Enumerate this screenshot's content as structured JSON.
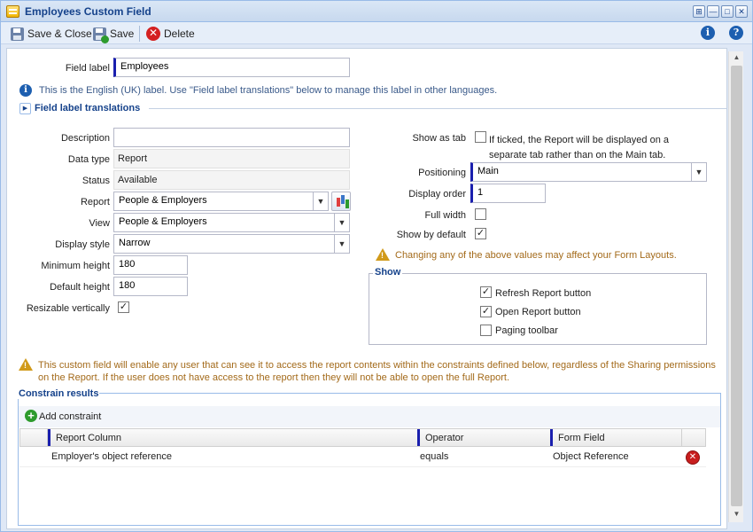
{
  "window": {
    "title": "Employees Custom Field",
    "buttons": {
      "pin": "⊞",
      "minimize": "—",
      "maximize": "□",
      "close": "✕"
    }
  },
  "toolbar": {
    "save_close": "Save & Close",
    "save": "Save",
    "delete": "Delete",
    "info_glyph": "i",
    "help_glyph": "?"
  },
  "form": {
    "field_label": {
      "label": "Field label",
      "value": "Employees"
    },
    "label_note": "This is the English (UK) label. Use \"Field label translations\" below to manage this label in other languages.",
    "translations_header": "Field label translations",
    "description": {
      "label": "Description",
      "value": ""
    },
    "data_type": {
      "label": "Data type",
      "value": "Report"
    },
    "status": {
      "label": "Status",
      "value": "Available"
    },
    "report": {
      "label": "Report",
      "value": "People & Employers"
    },
    "view": {
      "label": "View",
      "value": "People & Employers"
    },
    "display_style": {
      "label": "Display style",
      "value": "Narrow"
    },
    "min_height": {
      "label": "Minimum height",
      "value": "180"
    },
    "default_height": {
      "label": "Default height",
      "value": "180"
    },
    "resizable": {
      "label": "Resizable vertically",
      "checked": true
    },
    "show_as_tab": {
      "label": "Show as tab",
      "checked": false,
      "desc_line1": "If ticked, the Report will be displayed on a",
      "desc_line2": "separate tab rather than on the Main tab."
    },
    "positioning": {
      "label": "Positioning",
      "value": "Main"
    },
    "display_order": {
      "label": "Display order",
      "value": "1"
    },
    "full_width": {
      "label": "Full width",
      "checked": false
    },
    "show_by_default": {
      "label": "Show by default",
      "checked": true
    },
    "change_warning": "Changing any of the above values may affect your Form Layouts.",
    "show_group": {
      "legend": "Show",
      "refresh": {
        "label": "Refresh Report button",
        "checked": true
      },
      "open": {
        "label": "Open Report button",
        "checked": true
      },
      "paging": {
        "label": "Paging toolbar",
        "checked": false
      }
    },
    "access_warning_line1": "This custom field will enable any user that can see it to access the report contents within the constraints defined below, regardless of the Sharing permissions",
    "access_warning_line2": "on the Report. If the user does not have access to the report then they will not be able to open the full Report."
  },
  "constraints": {
    "title": "Constrain results",
    "add_label": "Add constraint",
    "columns": [
      "Report Column",
      "Operator",
      "Form Field"
    ],
    "rows": [
      {
        "report_column": "Employer's object reference",
        "operator": "equals",
        "form_field": "Object Reference"
      }
    ]
  },
  "colors": {
    "accent": "#15428b",
    "required_bar": "#1a1fae",
    "warning": "#a36a1a"
  }
}
